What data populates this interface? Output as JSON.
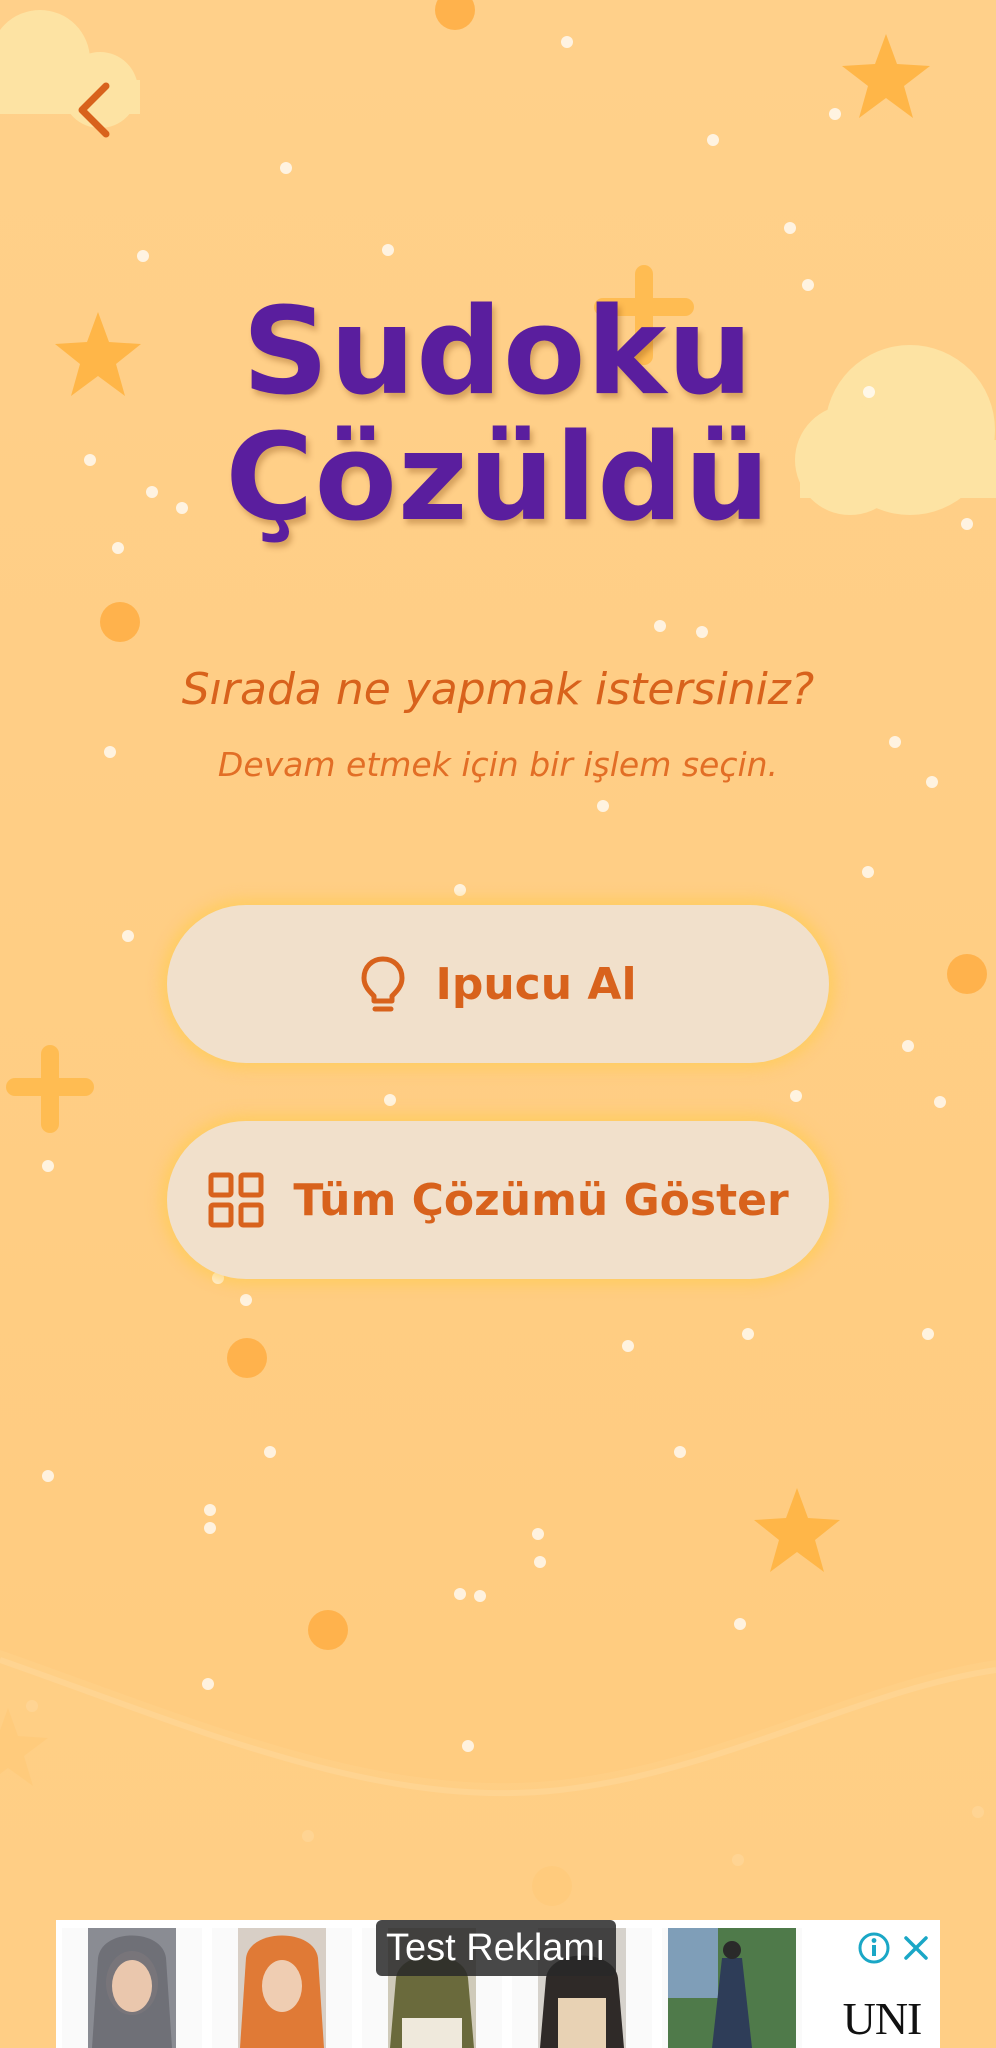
{
  "title": {
    "line1": "Sudoku",
    "line2": "Çözüldü"
  },
  "prompt": {
    "question": "Sırada ne yapmak istersiniz?",
    "subtitle": "Devam etmek için bir işlem seçin."
  },
  "actions": {
    "hint_label": "Ipucu Al",
    "show_solution_label": "Tüm Çözümü Göster"
  },
  "ad": {
    "label": "Test Reklamı",
    "brand": "UNI"
  },
  "icons": {
    "back": "chevron-left-icon",
    "hint": "lightbulb-icon",
    "solution": "grid-icon",
    "ad_info": "info-icon",
    "ad_close": "close-icon"
  },
  "colors": {
    "background": "#ffcf85",
    "title": "#5a1e9e",
    "accent": "#d8621c",
    "button_bg": "#f1e0cb"
  }
}
